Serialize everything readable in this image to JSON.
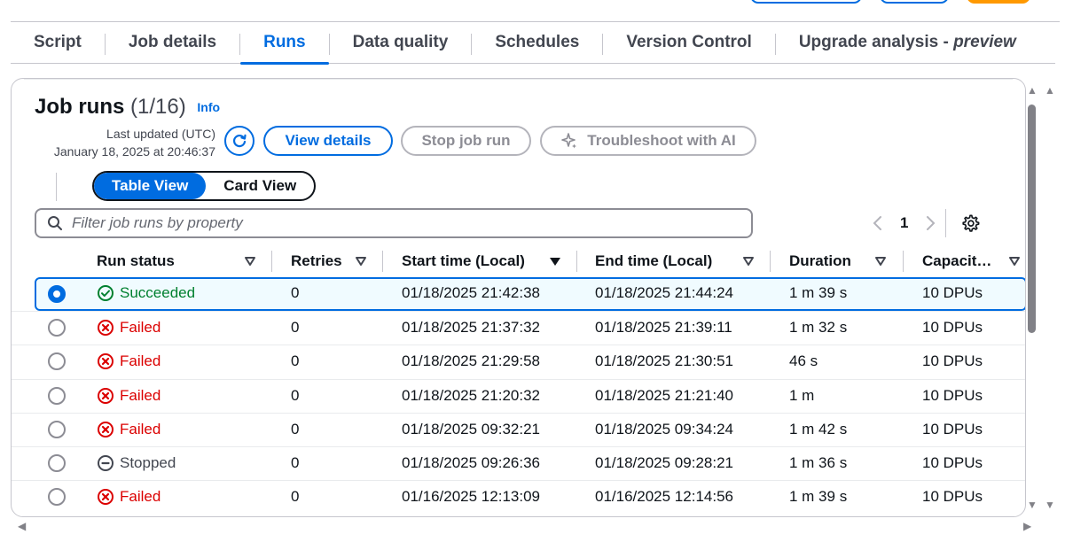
{
  "tabs": [
    {
      "label": "Script"
    },
    {
      "label": "Job details"
    },
    {
      "label": "Runs"
    },
    {
      "label": "Data quality"
    },
    {
      "label": "Schedules"
    },
    {
      "label": "Version Control"
    },
    {
      "label": "Upgrade analysis - ",
      "suffix": "preview"
    }
  ],
  "header": {
    "title": "Job runs",
    "count": "(1/16)",
    "info": "Info",
    "last_updated_label": "Last updated (UTC)",
    "last_updated_value": "January 18, 2025 at 20:46:37"
  },
  "actions": {
    "view_details": "View details",
    "stop_job_run": "Stop job run",
    "troubleshoot": "Troubleshoot with AI"
  },
  "view_toggle": {
    "table": "Table View",
    "card": "Card View",
    "selected": "Table View"
  },
  "filter": {
    "placeholder": "Filter job runs by property"
  },
  "pagination": {
    "current_page": "1"
  },
  "table": {
    "columns": [
      {
        "label": "Run status"
      },
      {
        "label": "Retries"
      },
      {
        "label": "Start time (Local)"
      },
      {
        "label": "End time (Local)"
      },
      {
        "label": "Duration"
      },
      {
        "label": "Capacit…"
      }
    ],
    "rows": [
      {
        "status": "Succeeded",
        "kind": "success",
        "retries": "0",
        "start": "01/18/2025 21:42:38",
        "end": "01/18/2025 21:44:24",
        "duration": "1 m 39 s",
        "capacity": "10 DPUs",
        "selected": true
      },
      {
        "status": "Failed",
        "kind": "failed",
        "retries": "0",
        "start": "01/18/2025 21:37:32",
        "end": "01/18/2025 21:39:11",
        "duration": "1 m 32 s",
        "capacity": "10 DPUs",
        "selected": false
      },
      {
        "status": "Failed",
        "kind": "failed",
        "retries": "0",
        "start": "01/18/2025 21:29:58",
        "end": "01/18/2025 21:30:51",
        "duration": "46 s",
        "capacity": "10 DPUs",
        "selected": false
      },
      {
        "status": "Failed",
        "kind": "failed",
        "retries": "0",
        "start": "01/18/2025 21:20:32",
        "end": "01/18/2025 21:21:40",
        "duration": "1 m",
        "capacity": "10 DPUs",
        "selected": false
      },
      {
        "status": "Failed",
        "kind": "failed",
        "retries": "0",
        "start": "01/18/2025 09:32:21",
        "end": "01/18/2025 09:34:24",
        "duration": "1 m 42 s",
        "capacity": "10 DPUs",
        "selected": false
      },
      {
        "status": "Stopped",
        "kind": "stopped",
        "retries": "0",
        "start": "01/18/2025 09:26:36",
        "end": "01/18/2025 09:28:21",
        "duration": "1 m 36 s",
        "capacity": "10 DPUs",
        "selected": false
      },
      {
        "status": "Failed",
        "kind": "failed",
        "retries": "0",
        "start": "01/16/2025 12:13:09",
        "end": "01/16/2025 12:14:56",
        "duration": "1 m 39 s",
        "capacity": "10 DPUs",
        "selected": false
      }
    ]
  },
  "colors": {
    "accent": "#006ce0",
    "success": "#00802f",
    "error": "#db0000",
    "neutral": "#424650"
  }
}
